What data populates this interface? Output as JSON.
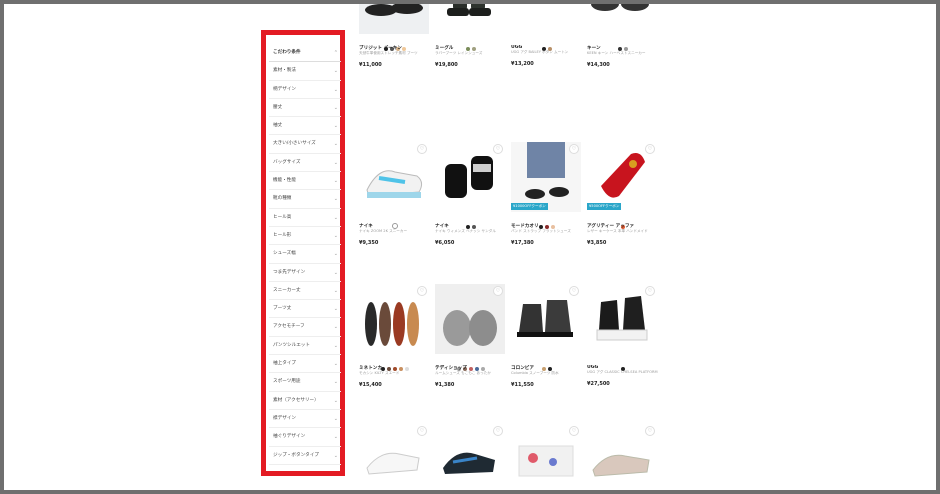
{
  "sidebar": {
    "header_label": "こだわり条件",
    "items": [
      "素材・製法",
      "柄デザイン",
      "腰丈",
      "袖丈",
      "大きい/小さいサイズ",
      "バッグサイズ",
      "機能・性能",
      "靴の種類",
      "ヒール高",
      "ヒール形",
      "シューズ幅",
      "つま先デザイン",
      "スニーカー丈",
      "ブーツ丈",
      "アクセモチーフ",
      "パンツシルエット",
      "袖上タイプ",
      "スポーツ用途",
      "素材（アクセサリー）",
      "襟デザイン",
      "袖ぐりデザイン",
      "ジップ・ボタンタイプ"
    ]
  },
  "products": [
    {
      "brand": "ブリジット バーキン",
      "desc": "天然牛革使用ストレッチ素材 ブーツ",
      "price": "¥11,000",
      "swatches": [
        "#222222",
        "#555555",
        "#d8b48a",
        "#f0c89a"
      ]
    },
    {
      "brand": "ミーグル",
      "desc": "ラバーブーツ レインシューズ",
      "price": "¥19,800",
      "swatches": [
        "#7a8c5a",
        "#a0a080"
      ]
    },
    {
      "brand": "UGG",
      "desc": "UGG アグ BAILEY ボタン ムートン",
      "price": "¥13,200",
      "swatches": [
        "#222222",
        "#b89068"
      ]
    },
    {
      "brand": "キーン",
      "desc": "KEEN キーン ハーベストスニーカー",
      "price": "¥14,300",
      "swatches": [
        "#333333",
        "#9a9a9a"
      ]
    },
    {
      "brand": "ナイキ",
      "desc": "ナイキ ZOOM 2K スニーカー",
      "price": "¥9,350",
      "swatches": [
        "#ffffff"
      ]
    },
    {
      "brand": "ナイキ",
      "desc": "ナイキ ウィメンズ ベナッシ サンダル",
      "price": "¥6,050",
      "swatches": [
        "#222222",
        "#555555"
      ]
    },
    {
      "brand": "モードカオリ",
      "desc": "バンド ストラップ フラットシューズ",
      "price": "¥17,380",
      "swatches": [
        "#222222",
        "#8a2a2a",
        "#e8c0a0"
      ],
      "coupon": "¥1000OFFクーポン"
    },
    {
      "brand": "アグリティー アッファ",
      "desc": "レザー キーケース 本革 ハンドメイド",
      "price": "¥3,850",
      "swatches": [
        "#e05a30"
      ],
      "coupon": "¥500OFFクーポン"
    },
    {
      "brand": "ミネトンカ",
      "desc": "モカシン KILTY スエード",
      "price": "¥15,400",
      "swatches": [
        "#222222",
        "#6a4a3a",
        "#a04a2a",
        "#c89060",
        "#dddddd"
      ]
    },
    {
      "brand": "テディショップ",
      "desc": "ルームシューズ もこもこ あったか",
      "price": "¥1,380",
      "swatches": [
        "#9a9a9a",
        "#8a6a5a",
        "#c06060",
        "#4a6a9a",
        "#aaaaaa"
      ]
    },
    {
      "brand": "コロンビア",
      "desc": "Columbia スノーブーツ 防水",
      "price": "¥11,550",
      "swatches": [
        "#c8a070",
        "#222222"
      ]
    },
    {
      "brand": "UGG",
      "desc": "UGG アグ CLASSIC CHELSEA PLATFORM",
      "price": "¥27,500",
      "swatches": [
        "#222222"
      ]
    },
    {
      "brand": "",
      "desc": "",
      "price": "",
      "swatches": []
    },
    {
      "brand": "",
      "desc": "",
      "price": "",
      "swatches": []
    },
    {
      "brand": "",
      "desc": "",
      "price": "",
      "swatches": []
    },
    {
      "brand": "",
      "desc": "",
      "price": "",
      "swatches": []
    }
  ]
}
